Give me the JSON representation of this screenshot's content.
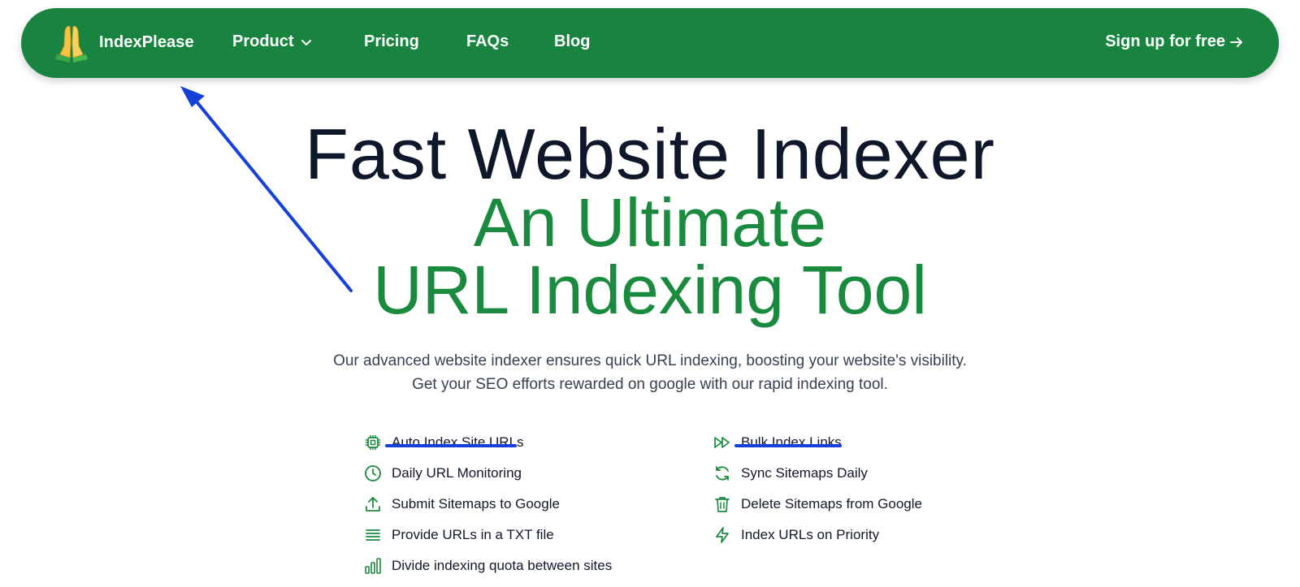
{
  "nav": {
    "brand": "IndexPlease",
    "items": [
      {
        "label": "Product",
        "has_dropdown": true
      },
      {
        "label": "Pricing"
      },
      {
        "label": "FAQs"
      },
      {
        "label": "Blog"
      }
    ],
    "cta": "Sign up for free"
  },
  "hero": {
    "line1": "Fast Website Indexer",
    "line2": "An Ultimate",
    "line3": "URL Indexing Tool",
    "subtitle1": "Our advanced website indexer ensures quick URL indexing, boosting your website's visibility.",
    "subtitle2": "Get your SEO efforts rewarded on google with our rapid indexing tool."
  },
  "features_left": [
    {
      "label": "Auto Index Site URLs",
      "icon": "chip-icon",
      "underlined": true
    },
    {
      "label": "Daily URL Monitoring",
      "icon": "clock-icon"
    },
    {
      "label": "Submit Sitemaps to Google",
      "icon": "upload-icon"
    },
    {
      "label": "Provide URLs in a TXT file",
      "icon": "list-lines-icon"
    },
    {
      "label": "Divide indexing quota between sites",
      "icon": "bar-chart-icon"
    }
  ],
  "features_right": [
    {
      "label": "Bulk Index Links",
      "icon": "fast-forward-icon",
      "underlined": true
    },
    {
      "label": "Sync Sitemaps Daily",
      "icon": "refresh-icon"
    },
    {
      "label": "Delete Sitemaps from Google",
      "icon": "trash-icon"
    },
    {
      "label": "Index URLs on Priority",
      "icon": "lightning-icon"
    }
  ],
  "colors": {
    "nav_bg": "#19843f",
    "accent_green": "#1a8a3e",
    "annotation_blue": "#1540d9"
  }
}
